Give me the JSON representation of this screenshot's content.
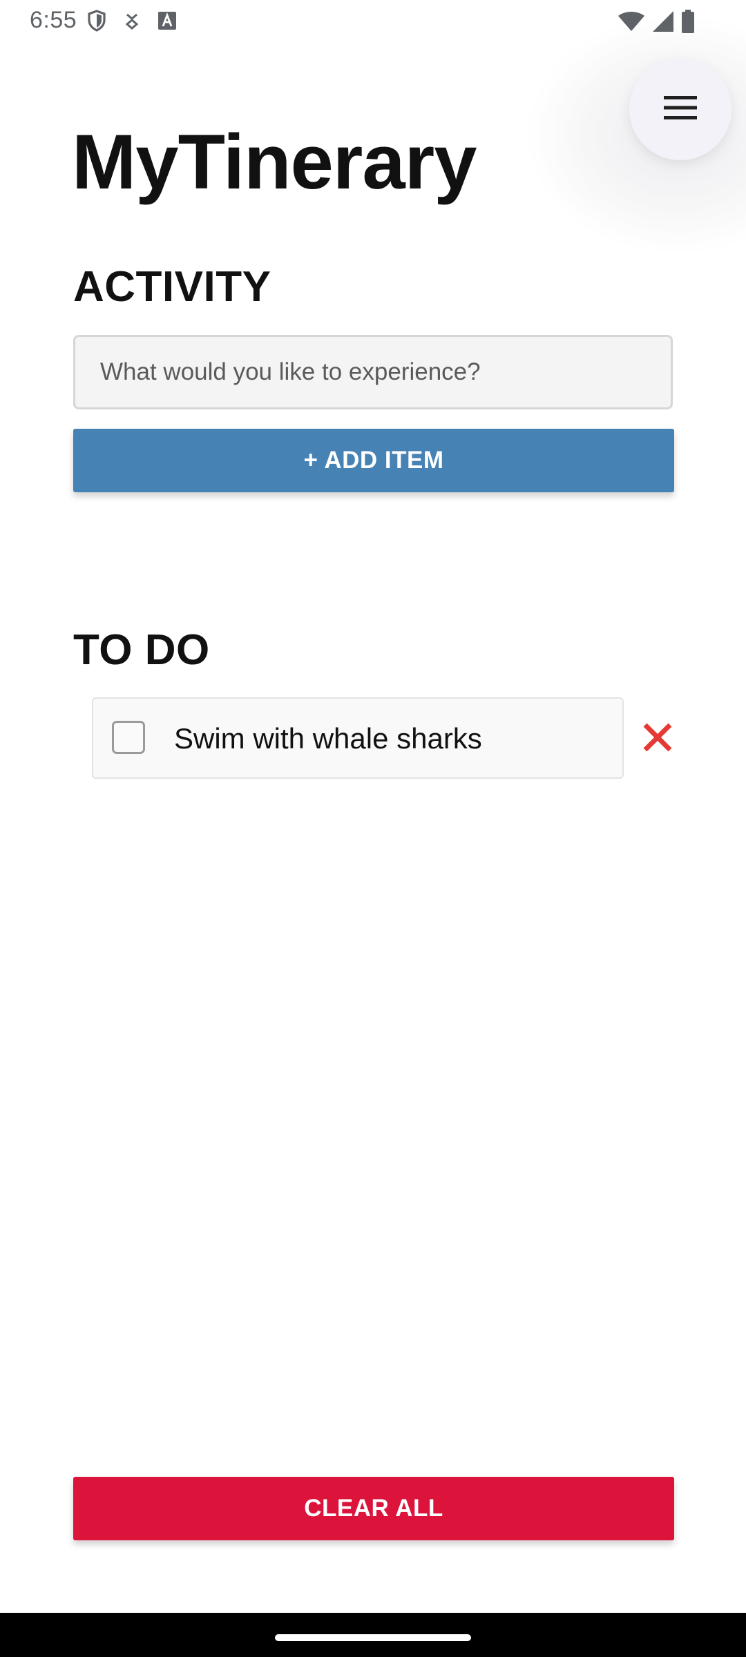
{
  "status_bar": {
    "time": "6:55",
    "left_icons": [
      "shield-icon",
      "download-icon",
      "text-a-icon"
    ],
    "right_icons": [
      "wifi-icon",
      "cell-signal-icon",
      "battery-icon"
    ]
  },
  "app": {
    "title": "MyTinerary",
    "menu_icon": "hamburger-menu-icon"
  },
  "activity": {
    "heading": "ACTIVITY",
    "input_value": "",
    "input_placeholder": "What would you like to experience?",
    "add_button_label": "+ ADD ITEM",
    "add_button_color": "#4682b4"
  },
  "todo": {
    "heading": "TO DO",
    "items": [
      {
        "label": "Swim with whale sharks",
        "checked": false,
        "delete_icon": "close-icon",
        "delete_color": "#e53935"
      }
    ]
  },
  "footer": {
    "clear_button_label": "CLEAR ALL",
    "clear_button_color": "#dc143c"
  }
}
